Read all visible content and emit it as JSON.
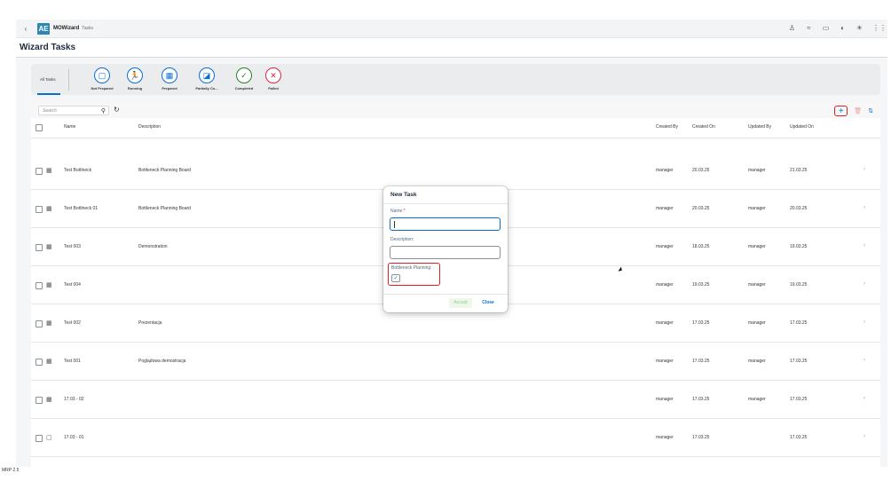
{
  "shell": {
    "back_icon": "‹",
    "logo_text": "AE",
    "app_name": "MOWizard",
    "app_sub": "Tasks",
    "icons": [
      "user-icon",
      "chart-icon",
      "screen-icon",
      "globe-icon",
      "brightness-icon",
      "grid-icon"
    ],
    "icon_glyphs": [
      "♙",
      "≈",
      "▭",
      "◐",
      "☀",
      "⋮⋮"
    ]
  },
  "page": {
    "title": "Wizard Tasks"
  },
  "tabs": {
    "all": "All Tasks",
    "items": [
      {
        "label": "Not Prepared",
        "glyph": "▢",
        "icon": "document-icon",
        "color": "blue"
      },
      {
        "label": "Running",
        "glyph": "🏃",
        "icon": "running-icon",
        "color": "blue"
      },
      {
        "label": "Prepared",
        "glyph": "▦",
        "icon": "calendar-icon",
        "color": "blue"
      },
      {
        "label": "Partially Co...",
        "glyph": "◪",
        "icon": "partial-icon",
        "color": "blue"
      },
      {
        "label": "Completed",
        "glyph": "✓",
        "icon": "completed-icon",
        "color": "green"
      },
      {
        "label": "Failed",
        "glyph": "✕",
        "icon": "failed-icon",
        "color": "red"
      }
    ]
  },
  "toolbar": {
    "search_placeholder": "Search",
    "search_icon": "⚲",
    "refresh_icon": "↻",
    "add_icon": "+",
    "delete_icon": "🗑",
    "sort_icon": "⇅"
  },
  "table": {
    "headers": {
      "name": "Name",
      "description": "Description",
      "created_by": "Created By",
      "created_on": "Created On",
      "updated_by": "Updated By",
      "updated_on": "Updated On"
    },
    "rows": [
      {
        "icon": "▦",
        "name": "Test Bottlneck",
        "description": "Bottleneck Planning Board",
        "created_by": "manager",
        "created_on": "20.03.25",
        "updated_by": "manager",
        "updated_on": "21.03.25"
      },
      {
        "icon": "▦",
        "name": "Test Bottlneck 01",
        "description": "Bottleneck Planning Board",
        "created_by": "manager",
        "created_on": "20.03.25",
        "updated_by": "manager",
        "updated_on": "20.03.25"
      },
      {
        "icon": "▦",
        "name": "Test 003",
        "description": "Demonstration",
        "created_by": "manager",
        "created_on": "18.03.25",
        "updated_by": "manager",
        "updated_on": "19.03.25"
      },
      {
        "icon": "▦",
        "name": "Test 004",
        "description": "",
        "created_by": "manager",
        "created_on": "19.03.25",
        "updated_by": "manager",
        "updated_on": "19.03.25"
      },
      {
        "icon": "▦",
        "name": "Test 002",
        "description": "Prezentacja",
        "created_by": "manager",
        "created_on": "17.03.25",
        "updated_by": "manager",
        "updated_on": "17.03.25"
      },
      {
        "icon": "▦",
        "name": "Test 001",
        "description": "Poglądowa demostracja",
        "created_by": "manager",
        "created_on": "17.03.25",
        "updated_by": "manager",
        "updated_on": "17.03.25"
      },
      {
        "icon": "▦",
        "name": "17.03 - 02",
        "description": "",
        "created_by": "manager",
        "created_on": "17.03.25",
        "updated_by": "manager",
        "updated_on": "17.03.25"
      },
      {
        "icon": "▢",
        "name": "17.03 - 01",
        "description": "",
        "created_by": "manager",
        "created_on": "17.03.25",
        "updated_by": "",
        "updated_on": "17.03.25"
      }
    ],
    "chevron": "›"
  },
  "dialog": {
    "title": "New Task",
    "name_label": "Name:",
    "name_required": "*",
    "name_value": "",
    "description_label": "Description:",
    "description_value": "",
    "bottleneck_label": "Bottleneck Planning:",
    "bottleneck_checked": true,
    "check_glyph": "✓",
    "accept_label": "Accept",
    "close_label": "Close"
  },
  "footer": {
    "version": "MRP 2.5"
  },
  "colors": {
    "accent": "#0a6ed1",
    "highlight": "#e02020",
    "success": "#2b7d2b",
    "error": "#d9263b"
  }
}
